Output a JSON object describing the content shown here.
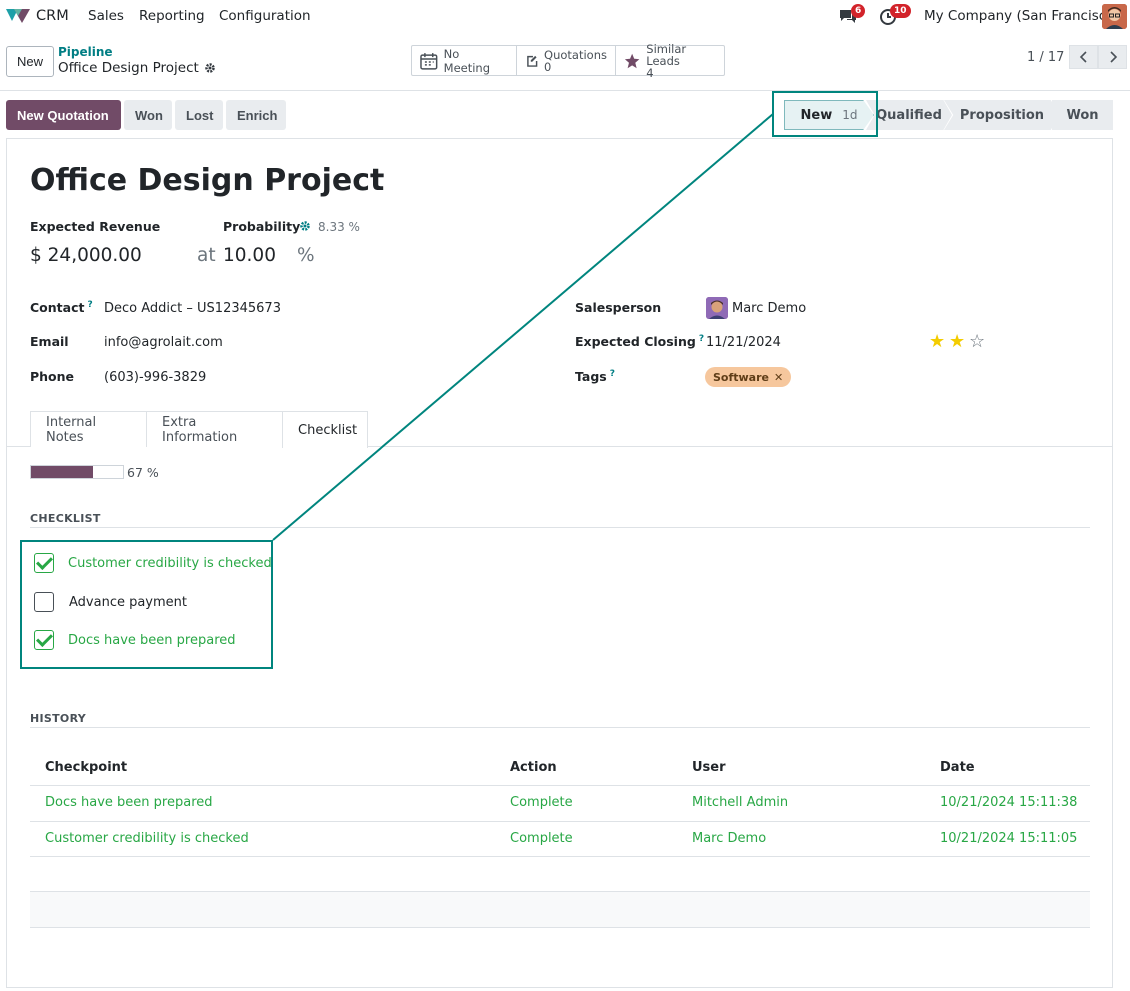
{
  "nav": {
    "app": "CRM",
    "menu": [
      "Sales",
      "Reporting",
      "Configuration"
    ],
    "messages_count": "6",
    "activities_count": "10",
    "company": "My Company (San Francisco)"
  },
  "control": {
    "new_label": "New",
    "breadcrumb_parent": "Pipeline",
    "breadcrumb_current": "Office Design Project",
    "smart_buttons": {
      "meeting": "No Meeting",
      "quotations_label": "Quotations",
      "quotations_count": "0",
      "similar_label": "Similar Leads",
      "similar_count": "4"
    },
    "pager": "1 / 17"
  },
  "actions": {
    "new_quotation": "New Quotation",
    "won": "Won",
    "lost": "Lost",
    "enrich": "Enrich"
  },
  "stages": {
    "new": "New",
    "new_duration": "1d",
    "qualified": "Qualified",
    "proposition": "Proposition",
    "won": "Won"
  },
  "form": {
    "title": "Office Design Project",
    "expected_revenue_label": "Expected Revenue",
    "expected_revenue": "$ 24,000.00",
    "at": "at",
    "probability_label": "Probability",
    "probability_auto": "8.33 %",
    "probability": "10.00",
    "percent": "%",
    "contact_label": "Contact",
    "contact": "Deco Addict – US12345673",
    "email_label": "Email",
    "email": "info@agrolait.com",
    "phone_label": "Phone",
    "phone": "(603)-996-3829",
    "salesperson_label": "Salesperson",
    "salesperson": "Marc Demo",
    "closing_label": "Expected Closing",
    "closing": "11/21/2024",
    "tags_label": "Tags",
    "tag": "Software",
    "priority_stars": 2,
    "help_mark": "?"
  },
  "tabs": [
    "Internal Notes",
    "Extra Information",
    "Checklist"
  ],
  "checklist": {
    "progress": 0.67,
    "progress_label": "67 %",
    "heading": "CHECKLIST",
    "items": [
      {
        "label": "Customer credibility is checked",
        "done": true
      },
      {
        "label": "Advance payment",
        "done": false
      },
      {
        "label": "Docs have been prepared",
        "done": true
      }
    ]
  },
  "history": {
    "heading": "HISTORY",
    "columns": [
      "Checkpoint",
      "Action",
      "User",
      "Date"
    ],
    "rows": [
      [
        "Docs have been prepared",
        "Complete",
        "Mitchell Admin",
        "10/21/2024 15:11:38"
      ],
      [
        "Customer credibility is checked",
        "Complete",
        "Marc Demo",
        "10/21/2024 15:11:05"
      ]
    ]
  },
  "colors": {
    "primary": "#714b67",
    "teal": "#017e84",
    "success": "#28a745",
    "annotation": "#00857e"
  }
}
